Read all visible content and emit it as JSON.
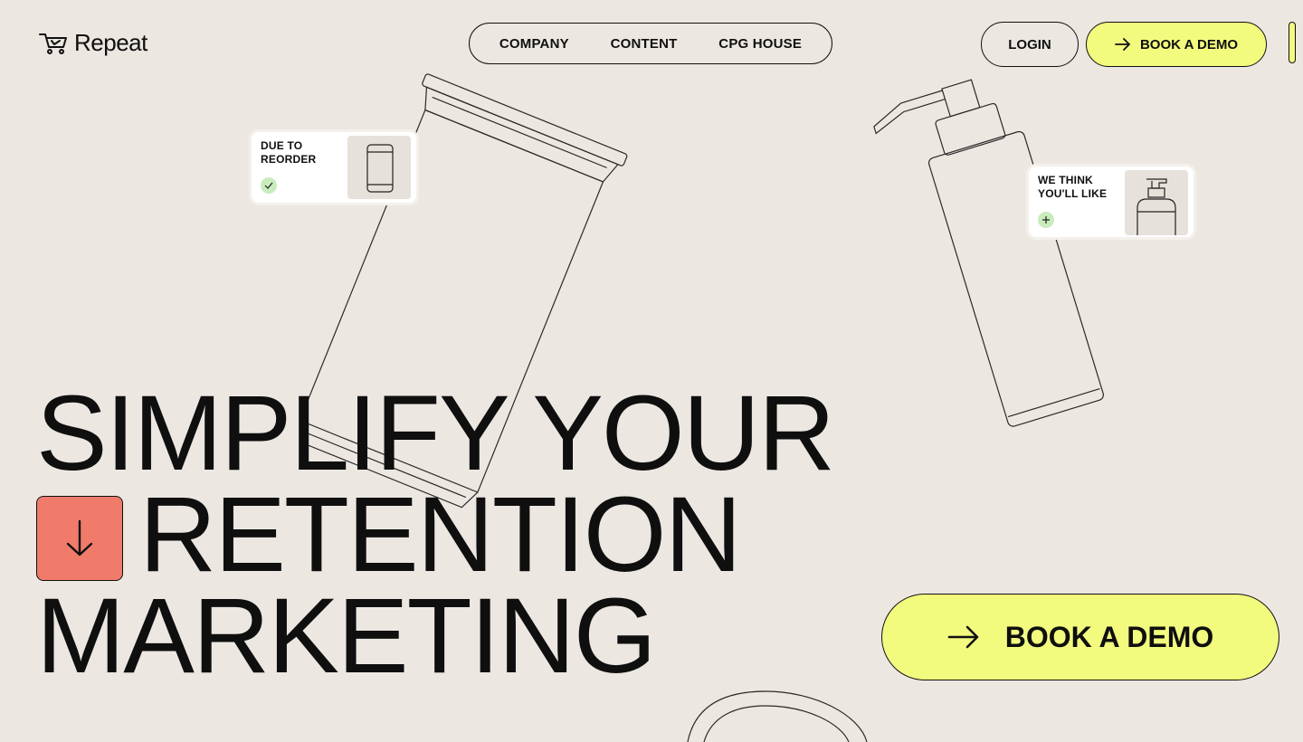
{
  "brand": {
    "name": "Repeat",
    "icon": "cart-logo-icon"
  },
  "nav": {
    "links": [
      "COMPANY",
      "CONTENT",
      "CPG HOUSE"
    ]
  },
  "header": {
    "login_label": "LOGIN",
    "demo_label": "BOOK A DEMO"
  },
  "cards": [
    {
      "label": "DUE TO\nREORDER",
      "badge_icon": "check-icon",
      "image": "can-icon"
    },
    {
      "label": "WE THINK\nYOU'LL LIKE",
      "badge_icon": "plus-icon",
      "image": "pump-bottle-icon"
    }
  ],
  "hero": {
    "line1": "SIMPLIFY YOUR",
    "line2": "RETENTION",
    "line3": "MARKETING",
    "cta_label": "BOOK A DEMO"
  },
  "colors": {
    "background": "#ece7e1",
    "accent_yellow": "#f3fb7f",
    "accent_coral": "#f07b6b",
    "badge_green": "#c9ecbd"
  }
}
